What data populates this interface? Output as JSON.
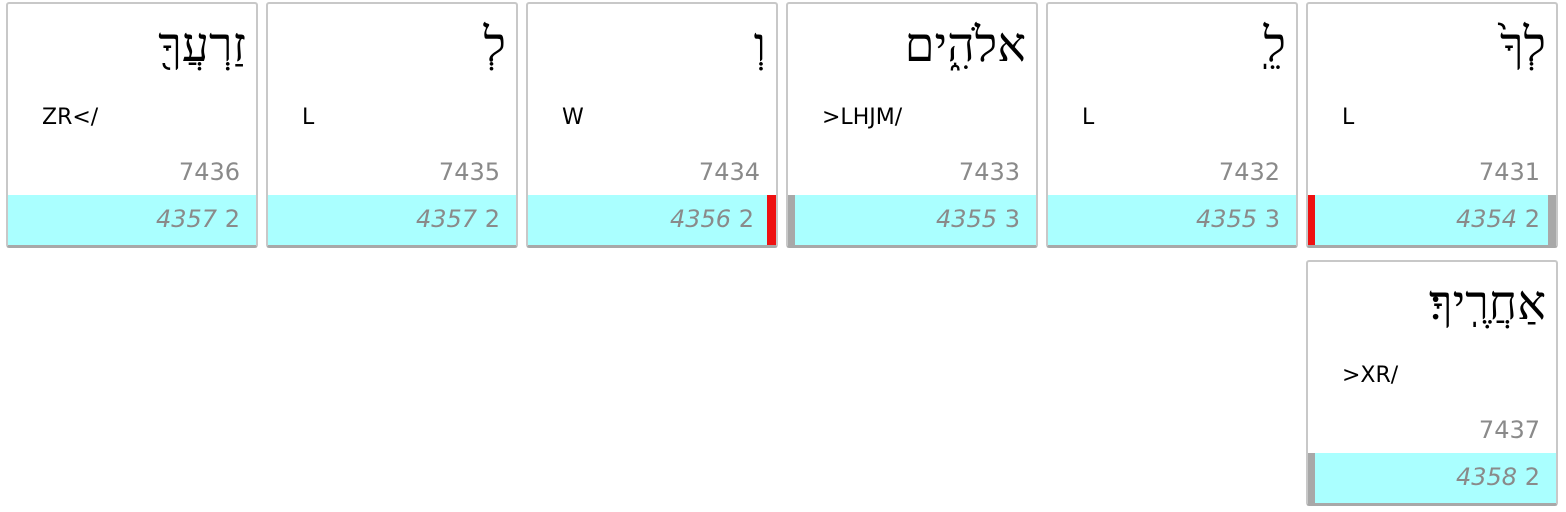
{
  "words": [
    {
      "hebrew": "לְךָ֙",
      "lex": "L",
      "num": "7431",
      "phrase": "4354",
      "count": "2"
    },
    {
      "hebrew": "לֵֽ",
      "lex": "L",
      "num": "7432",
      "phrase": "4355",
      "count": "3"
    },
    {
      "hebrew": "אלֹהִ֑ים",
      "lex": ">LHJM/",
      "num": "7433",
      "phrase": "4355",
      "count": "3"
    },
    {
      "hebrew": "וְ",
      "lex": "W",
      "num": "7434",
      "phrase": "4356",
      "count": "2"
    },
    {
      "hebrew": "לְ",
      "lex": "L",
      "num": "7435",
      "phrase": "4357",
      "count": "2"
    },
    {
      "hebrew": "זַרְעֲךָ֖",
      "lex": "ZR</",
      "num": "7436",
      "phrase": "4357",
      "count": "2"
    },
    {
      "hebrew": "אַחֲרֶֽיךָ׃",
      "lex": ">XR/",
      "num": "7437",
      "phrase": "4358",
      "count": "2"
    }
  ],
  "colors": {
    "phrase_bg": "#aaffff",
    "boundary_red": "#ee1111",
    "boundary_gray": "#a8a8a8"
  }
}
